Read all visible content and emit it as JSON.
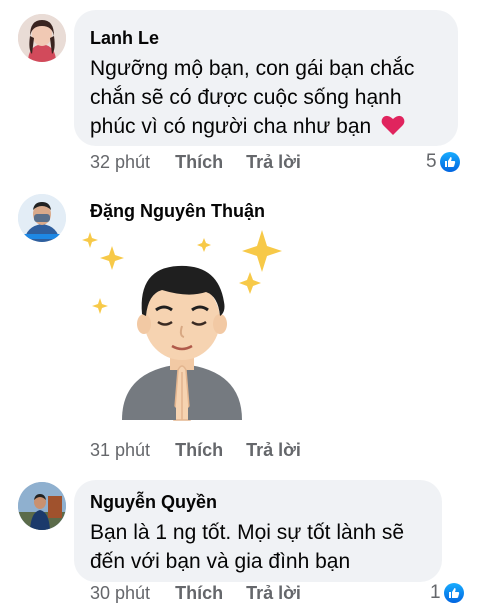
{
  "comments": [
    {
      "author": "Lanh Le",
      "lines": [
        "Ngưỡng mộ bạn, con gái bạn chắc",
        "chắn sẽ có được cuộc sống hạnh",
        "phúc vì có người cha như bạn"
      ],
      "time": "32 phút",
      "like_label": "Thích",
      "reply_label": "Trả lời",
      "reaction_count": "5",
      "emoji": "heart-icon"
    },
    {
      "author": "Đặng Nguyên Thuận",
      "sticker": "praying-avatar-sticker",
      "time": "31 phút",
      "like_label": "Thích",
      "reply_label": "Trả lời"
    },
    {
      "author": "Nguyễn Quyền",
      "lines": [
        "Bạn là 1 ng tốt. Mọi sự tốt lành sẽ",
        "đến với bạn và gia đình bạn"
      ],
      "time": "30 phút",
      "like_label": "Thích",
      "reply_label": "Trả lời",
      "reaction_count": "1"
    }
  ],
  "colors": {
    "bubble": "#f0f2f5",
    "meta_text": "#65676b",
    "like_blue": "#1877f2",
    "heart_red": "#e0245e"
  }
}
